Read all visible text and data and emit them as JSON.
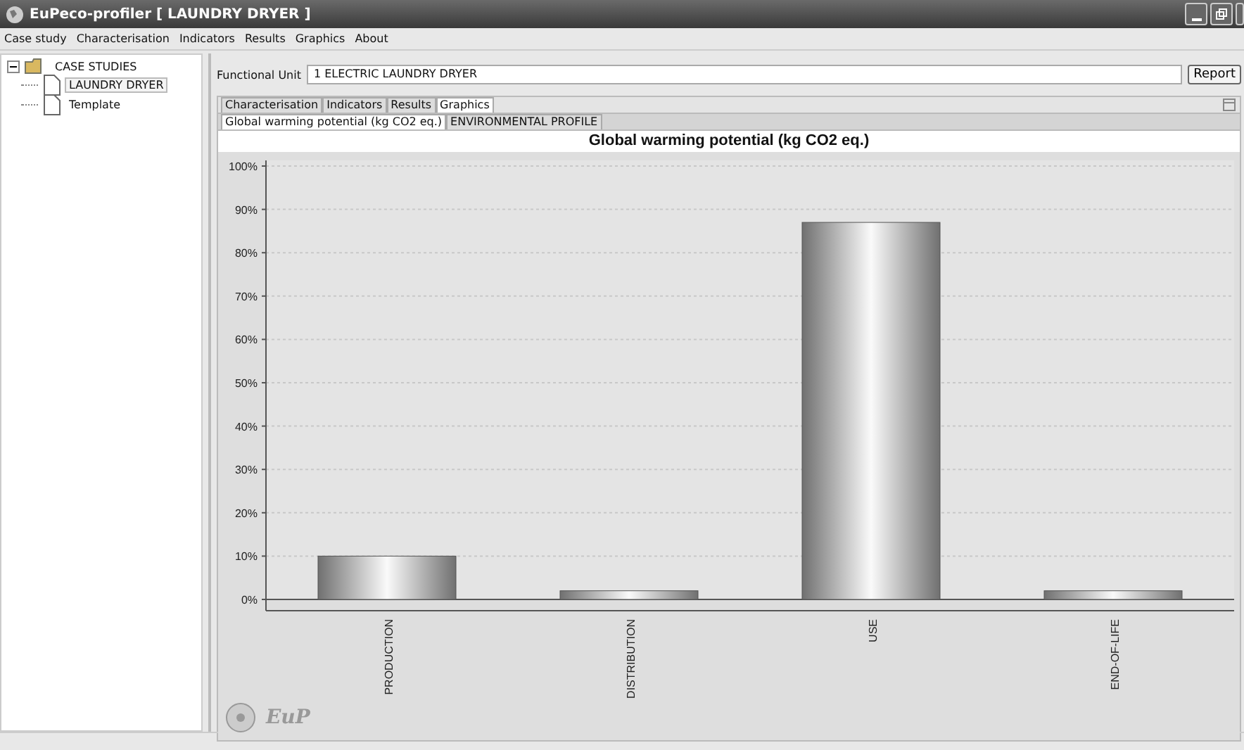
{
  "window": {
    "title": "EuPeco-profiler [ LAUNDRY DRYER ]"
  },
  "menu": [
    "Case study",
    "Characterisation",
    "Indicators",
    "Results",
    "Graphics",
    "About"
  ],
  "tree": [
    {
      "label": "CASE STUDIES",
      "expanded": true,
      "selected": false,
      "children": [
        {
          "label": "LAUNDRY DRYER",
          "selected": true
        },
        {
          "label": "Template",
          "selected": false
        }
      ]
    }
  ],
  "functional_unit": {
    "label": "Functional Unit",
    "value": "1 ELECTRIC LAUNDRY DRYER"
  },
  "report_button": "Report",
  "tabs": [
    {
      "label": "Characterisation",
      "selected": false
    },
    {
      "label": "Indicators",
      "selected": false
    },
    {
      "label": "Results",
      "selected": false
    },
    {
      "label": "Graphics",
      "selected": true
    }
  ],
  "subtabs": [
    {
      "label": "Global warming potential (kg CO2 eq.)",
      "selected": true
    },
    {
      "label": "ENVIRONMENTAL PROFILE",
      "selected": false
    }
  ],
  "chart": {
    "chart_data": {
      "type": "bar",
      "grid": true,
      "title": "Global warming potential (kg CO2 eq.)",
      "categories": [
        "PRODUCTION",
        "DISTRIBUTION",
        "USE",
        "END-OF-LIFE"
      ],
      "values": [
        10,
        2,
        87,
        2
      ],
      "ylim": [
        0,
        100
      ],
      "yticks": [
        {
          "value": 0,
          "label": "0%"
        },
        {
          "value": 10,
          "label": "10%"
        },
        {
          "value": 20,
          "label": "20%"
        },
        {
          "value": 30,
          "label": "30%"
        },
        {
          "value": 40,
          "label": "40%"
        },
        {
          "value": 50,
          "label": "50%"
        },
        {
          "value": 60,
          "label": "60%"
        },
        {
          "value": 70,
          "label": "70%"
        },
        {
          "value": 80,
          "label": "80%"
        },
        {
          "value": 90,
          "label": "90%"
        },
        {
          "value": 100,
          "label": "100%"
        }
      ]
    }
  },
  "logo": "EuP"
}
